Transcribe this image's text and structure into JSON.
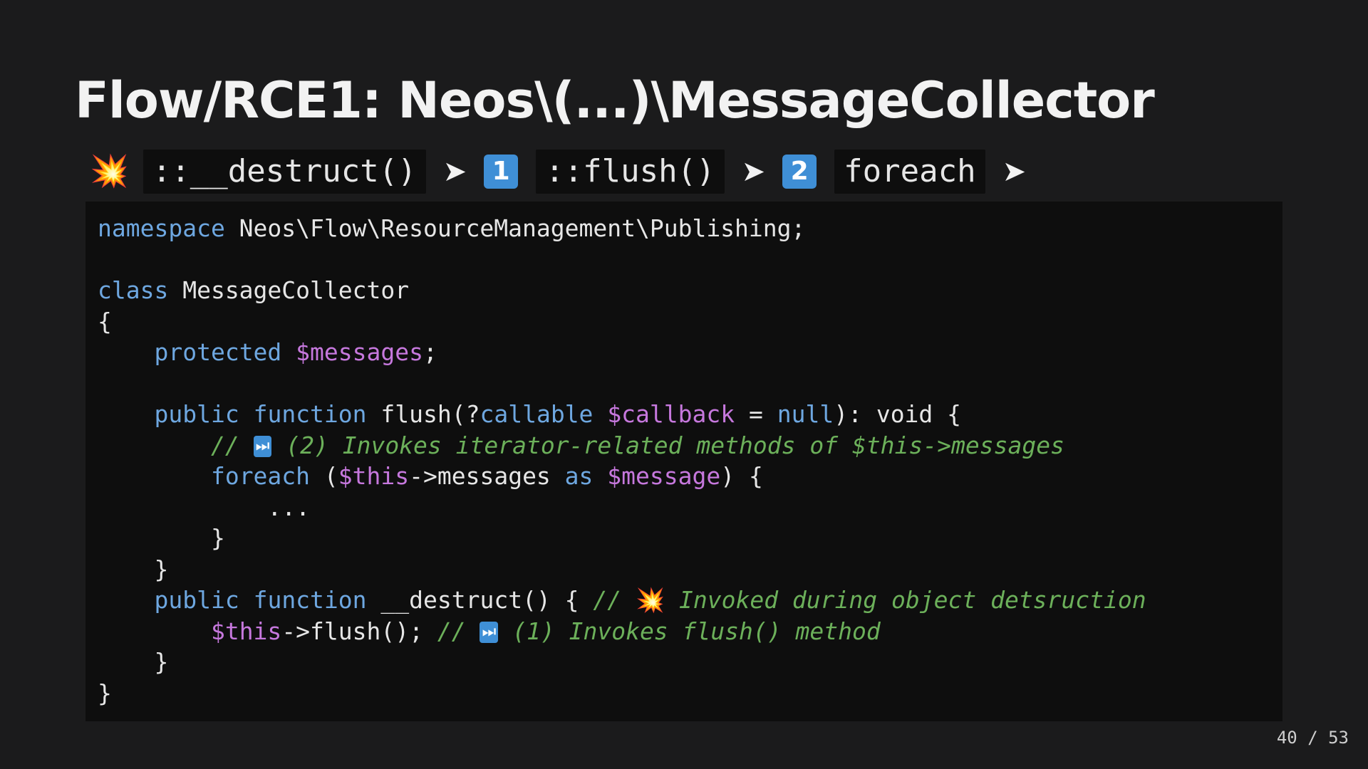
{
  "slide": {
    "title": "Flow/RCE1: Neos\\(...)\\MessageCollector",
    "page_current": "40",
    "page_separator": "/",
    "page_total": "53"
  },
  "chain": {
    "start_icon": "collision-icon",
    "start_glyph": "💥",
    "step1": "::__destruct()",
    "arrow": "➤",
    "badge1": "1",
    "step2": "::flush()",
    "badge2": "2",
    "step3": "foreach"
  },
  "colors": {
    "background": "#1b1b1c",
    "code_background": "#0e0e0e",
    "keyword": "#6ea7e0",
    "variable": "#c678dd",
    "comment": "#6cb05a",
    "badge": "#3f8fd6"
  },
  "code": {
    "l1": {
      "kw": "namespace",
      "rest": " Neos\\Flow\\ResourceManagement\\Publishing;"
    },
    "l3": {
      "kw": "class",
      "rest": " MessageCollector"
    },
    "l4": {
      "text": "{"
    },
    "l5": {
      "indent": "    ",
      "kw": "protected",
      "sp": " ",
      "var": "$messages",
      "rest": ";"
    },
    "l7": {
      "indent": "    ",
      "kw1": "public",
      "sp1": " ",
      "kw2": "function",
      "name": " flush(?",
      "kw3": "callable",
      "sp2": " ",
      "var": "$callback",
      "eq": " = ",
      "kw4": "null",
      "rest": "): void {"
    },
    "l8": {
      "indent": "        ",
      "cmt_a": "// ",
      "icon": "⏭",
      "cmt_b": " (2) Invokes iterator-related methods of $this->messages"
    },
    "l9": {
      "indent": "        ",
      "kw1": "foreach",
      "open": " (",
      "var1": "$this",
      "mid": "->messages ",
      "kw2": "as",
      "sp": " ",
      "var2": "$message",
      "rest": ") {"
    },
    "l10": {
      "text": "            ..."
    },
    "l11": {
      "text": "        }"
    },
    "l12": {
      "text": "    }"
    },
    "l13": {
      "indent": "    ",
      "kw1": "public",
      "sp1": " ",
      "kw2": "function",
      "rest": " __destruct() { ",
      "cmt_a": "// ",
      "icon": "💥",
      "cmt_b": " Invoked during object detsruction"
    },
    "l14": {
      "indent": "        ",
      "var": "$this",
      "rest": "->flush(); ",
      "cmt_a": "// ",
      "icon": "⏭",
      "cmt_b": " (1) Invokes flush() method"
    },
    "l15": {
      "text": "    }"
    },
    "l16": {
      "text": "}"
    }
  }
}
